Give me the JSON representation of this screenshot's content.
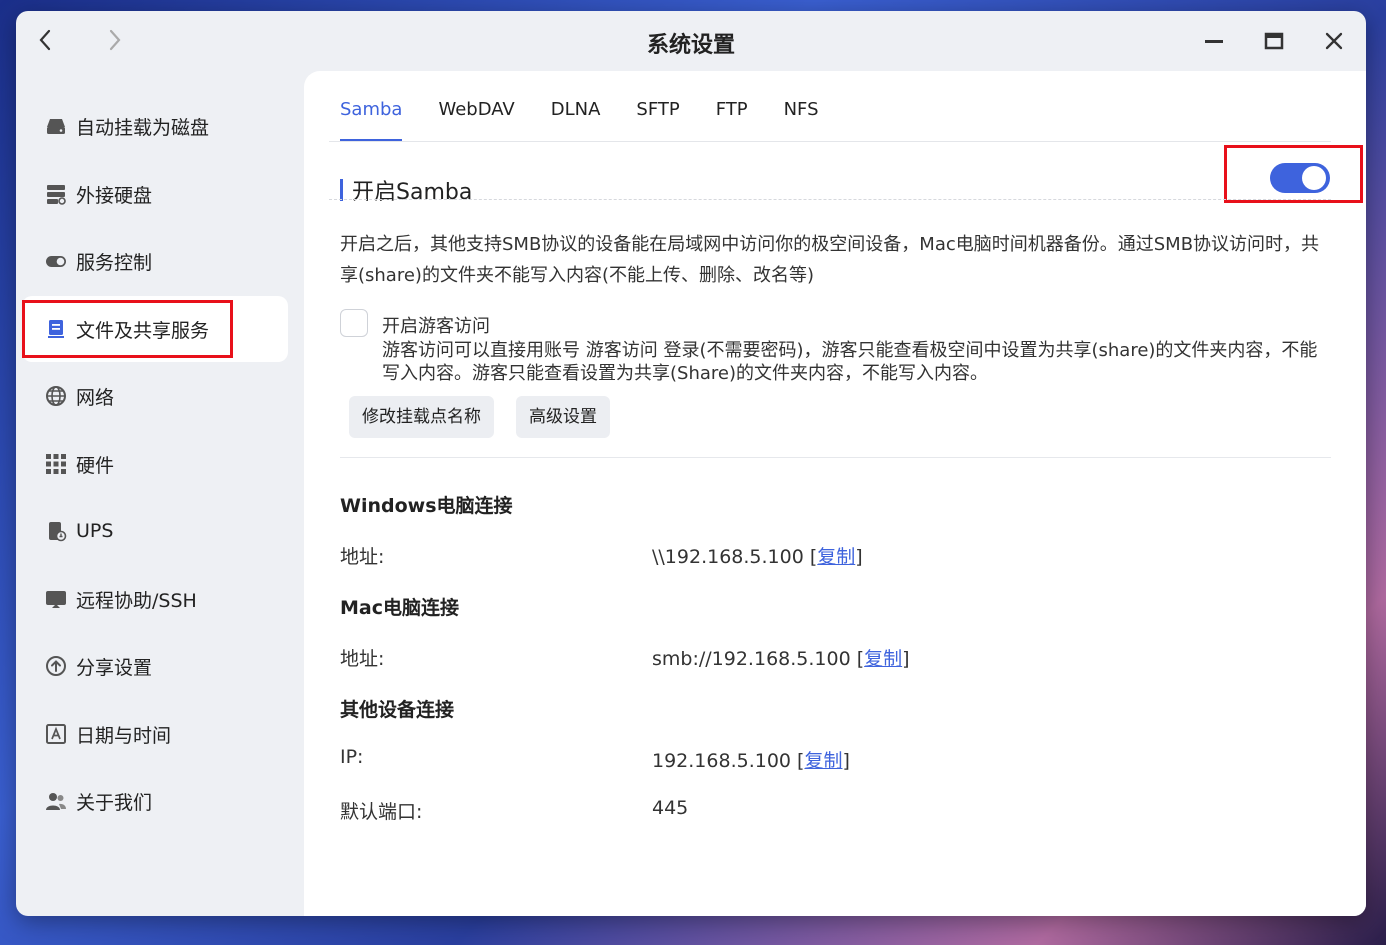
{
  "window": {
    "title": "系统设置"
  },
  "sidebar": {
    "items": [
      {
        "label": "自动挂载为磁盘",
        "icon": "disk-drive-icon"
      },
      {
        "label": "外接硬盘",
        "icon": "external-drive-icon"
      },
      {
        "label": "服务控制",
        "icon": "toggle-icon"
      },
      {
        "label": "文件及共享服务",
        "icon": "file-share-icon",
        "active": true
      },
      {
        "label": "网络",
        "icon": "globe-icon"
      },
      {
        "label": "硬件",
        "icon": "grid-icon"
      },
      {
        "label": "UPS",
        "icon": "ups-icon"
      },
      {
        "label": "远程协助/SSH",
        "icon": "monitor-icon"
      },
      {
        "label": "分享设置",
        "icon": "share-upload-icon"
      },
      {
        "label": "日期与时间",
        "icon": "calendar-icon"
      },
      {
        "label": "关于我们",
        "icon": "users-icon"
      }
    ]
  },
  "tabs": [
    {
      "label": "Samba",
      "active": true
    },
    {
      "label": "WebDAV"
    },
    {
      "label": "DLNA"
    },
    {
      "label": "SFTP"
    },
    {
      "label": "FTP"
    },
    {
      "label": "NFS"
    }
  ],
  "samba": {
    "enable_label": "开启Samba",
    "enabled": true,
    "description": "开启之后，其他支持SMB协议的设备能在局域网中访问你的极空间设备，Mac电脑时间机器备份。通过SMB协议访问时，共享(share)的文件夹不能写入内容(不能上传、删除、改名等)",
    "guest_label": "开启游客访问",
    "guest_checked": false,
    "guest_description": "游客访问可以直接用账号 游客访问 登录(不需要密码)，游客只能查看极空间中设置为共享(share)的文件夹内容，不能写入内容。游客只能查看设置为共享(Share)的文件夹内容，不能写入内容。",
    "rename_button": "修改挂载点名称",
    "advanced_button": "高级设置"
  },
  "connections": {
    "windows_title": "Windows电脑连接",
    "windows_addr_label": "地址:",
    "windows_addr": "\\\\192.168.5.100",
    "mac_title": "Mac电脑连接",
    "mac_addr_label": "地址:",
    "mac_addr": "smb://192.168.5.100",
    "other_title": "其他设备连接",
    "ip_label": "IP:",
    "ip": "192.168.5.100",
    "port_label": "默认端口:",
    "port": "445",
    "copy_label": "复制"
  },
  "colors": {
    "accent": "#3e63dd",
    "highlight": "#e8101a"
  }
}
